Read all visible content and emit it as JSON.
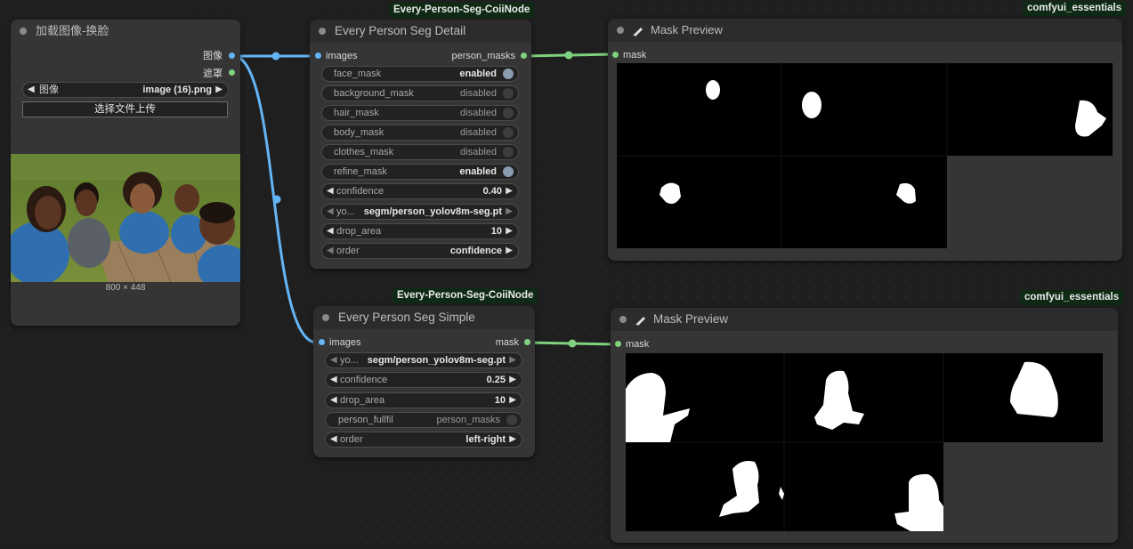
{
  "load_node": {
    "title": "加载图像-换脸",
    "outputs": [
      "图像",
      "遮罩"
    ],
    "image_widget": {
      "label": "图像",
      "value": "image (16).png"
    },
    "upload_button": "选择文件上传",
    "image_size": "800 × 448"
  },
  "seg_detail": {
    "badge": "Every-Person-Seg-CoiiNode",
    "title": "Every Person Seg Detail",
    "input": "images",
    "output": "person_masks",
    "toggles": [
      {
        "label": "face_mask",
        "value": "enabled"
      },
      {
        "label": "background_mask",
        "value": "disabled"
      },
      {
        "label": "hair_mask",
        "value": "disabled"
      },
      {
        "label": "body_mask",
        "value": "disabled"
      },
      {
        "label": "clothes_mask",
        "value": "disabled"
      },
      {
        "label": "refine_mask",
        "value": "enabled"
      }
    ],
    "confidence": {
      "label": "confidence",
      "value": "0.40"
    },
    "model": {
      "label": "yo...",
      "value": "segm/person_yolov8m-seg.pt"
    },
    "drop_area": {
      "label": "drop_area",
      "value": "10"
    },
    "order": {
      "label": "order",
      "value": "confidence"
    }
  },
  "seg_simple": {
    "badge": "Every-Person-Seg-CoiiNode",
    "title": "Every Person Seg Simple",
    "input": "images",
    "output": "mask",
    "model": {
      "label": "yo...",
      "value": "segm/person_yolov8m-seg.pt"
    },
    "confidence": {
      "label": "confidence",
      "value": "0.25"
    },
    "drop_area": {
      "label": "drop_area",
      "value": "10"
    },
    "person_fullfil": {
      "label": "person_fullfil",
      "value": "person_masks"
    },
    "order": {
      "label": "order",
      "value": "left-right"
    }
  },
  "preview_top": {
    "badge": "comfyui_essentials",
    "title": "Mask Preview",
    "input": "mask"
  },
  "preview_bottom": {
    "badge": "comfyui_essentials",
    "title": "Mask Preview",
    "input": "mask"
  },
  "colors": {
    "canvas": "#1f1f1f",
    "node": "#353535",
    "image_link": "#64b5f6",
    "mask_link": "#7ed17e",
    "badge_bg": "#0f2a14"
  },
  "icons": [
    "pencil-icon",
    "arrow-left-icon",
    "arrow-right-icon"
  ]
}
